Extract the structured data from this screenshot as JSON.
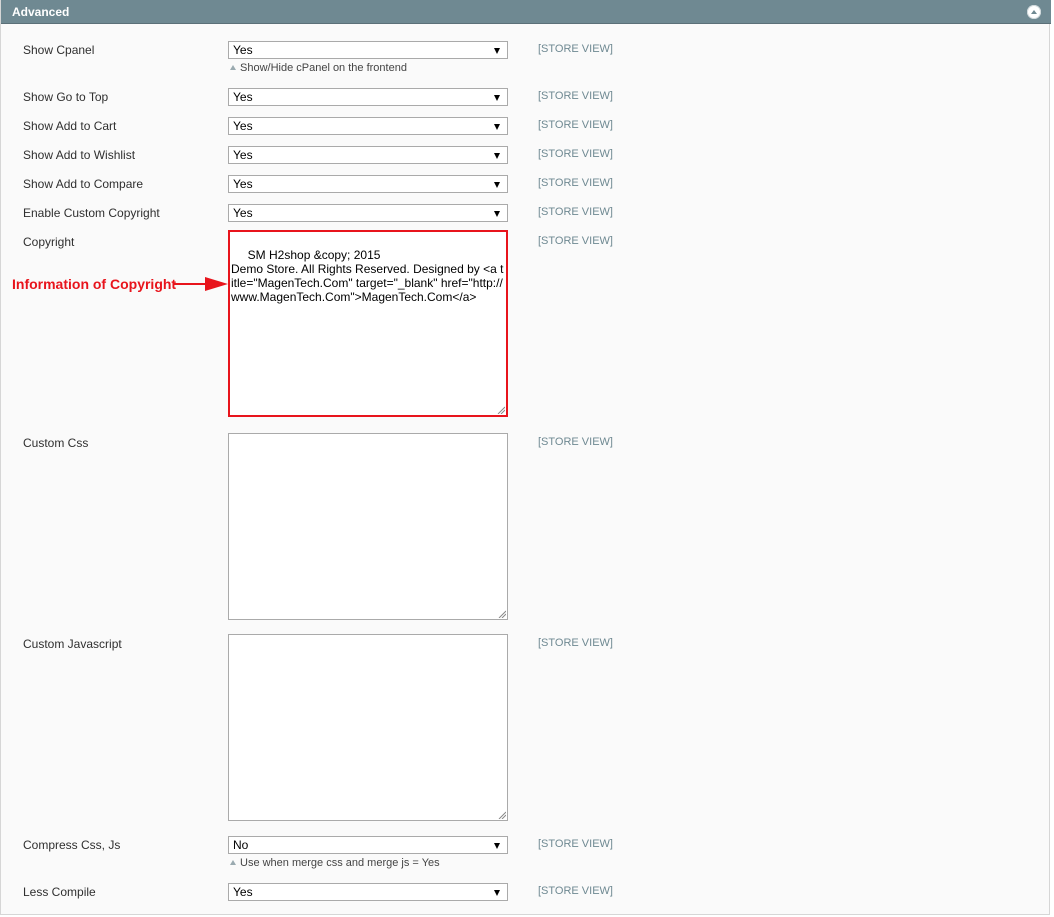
{
  "section": {
    "title": "Advanced",
    "collapse_icon": "collapse-up-icon"
  },
  "scope_label": "[STORE VIEW]",
  "fields": {
    "show_cpanel": {
      "label": "Show Cpanel",
      "value": "Yes",
      "note": "Show/Hide cPanel on the frontend"
    },
    "show_go_to_top": {
      "label": "Show Go to Top",
      "value": "Yes"
    },
    "show_add_to_cart": {
      "label": "Show Add to Cart",
      "value": "Yes"
    },
    "show_add_to_wishlist": {
      "label": "Show Add to Wishlist",
      "value": "Yes"
    },
    "show_add_to_compare": {
      "label": "Show Add to Compare",
      "value": "Yes"
    },
    "enable_custom_copyright": {
      "label": "Enable Custom Copyright",
      "value": "Yes"
    },
    "copyright": {
      "label": "Copyright",
      "value": " SM H2shop &copy; 2015\nDemo Store. All Rights Reserved. Designed by <a title=\"MagenTech.Com\" target=\"_blank\" href=\"http://www.MagenTech.Com\">MagenTech.Com</a>"
    },
    "custom_css": {
      "label": "Custom Css",
      "value": ""
    },
    "custom_javascript": {
      "label": "Custom Javascript",
      "value": ""
    },
    "compress_css_js": {
      "label": "Compress Css, Js",
      "value": "No",
      "note": "Use when merge css and merge js = Yes"
    },
    "less_compile": {
      "label": "Less Compile",
      "value": "Yes"
    }
  },
  "annotation": {
    "text": "Information of Copyright",
    "color": "#e8141c"
  },
  "colors": {
    "header_bg": "#6f8992",
    "scope_text": "#6f8992",
    "highlight": "#e8141c"
  }
}
